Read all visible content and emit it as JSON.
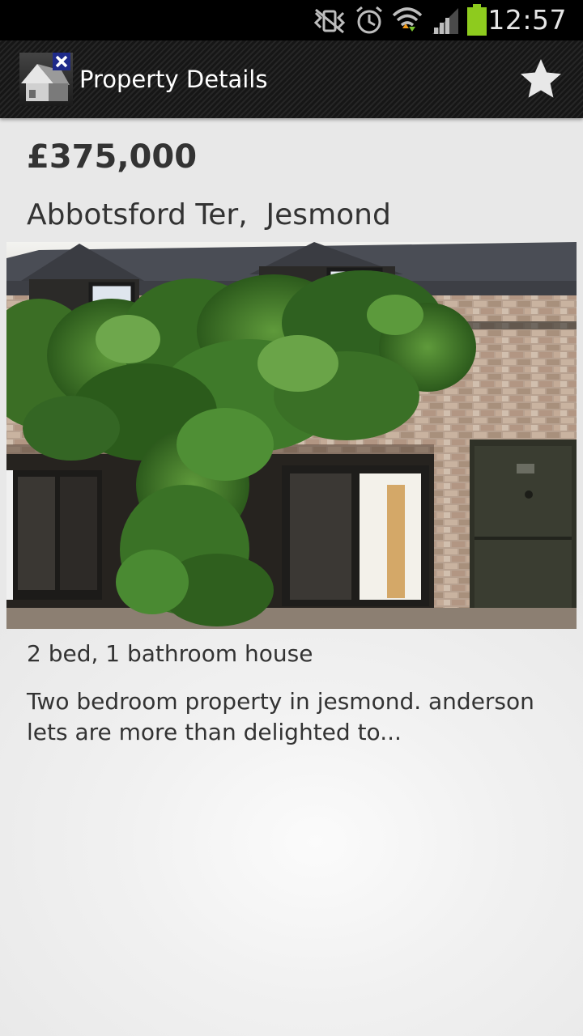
{
  "status_bar": {
    "time": "12:57",
    "icons": [
      "no-signal-bars-icon",
      "alarm-clock-icon",
      "wifi-icon",
      "cell-signal-icon",
      "battery-icon"
    ],
    "battery_color": "#8ecb1e"
  },
  "action_bar": {
    "title": "Property Details",
    "logo_icon": "house-logo-icon",
    "favorite_icon": "star-icon"
  },
  "listing": {
    "price": "£375,000",
    "address": "Abbotsford Ter,  Jesmond",
    "photo_icon": "property-photo",
    "summary": "2 bed, 1 bathroom house",
    "description": "Two bedroom property in jesmond. anderson lets are more than delighted to..."
  }
}
